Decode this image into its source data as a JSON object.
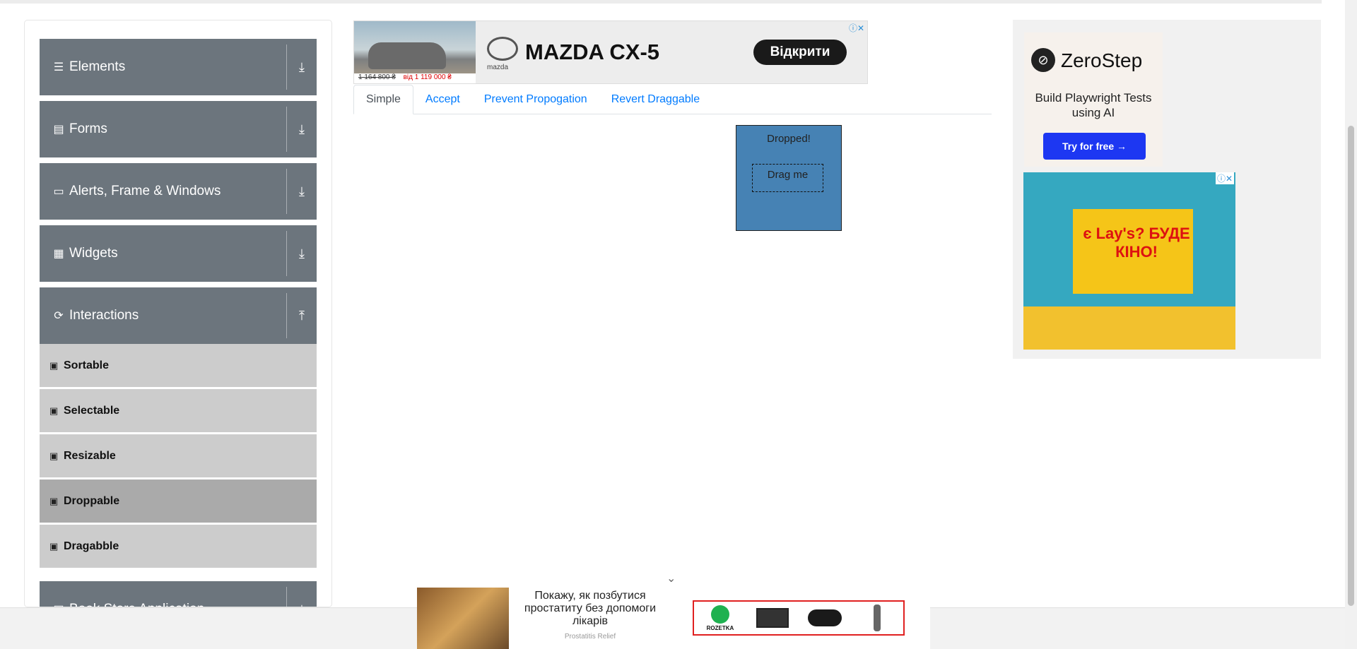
{
  "sidebar": {
    "groups": [
      {
        "label": "Elements",
        "icon": "menu-icon"
      },
      {
        "label": "Forms",
        "icon": "form-icon"
      },
      {
        "label": "Alerts, Frame & Windows",
        "icon": "window-icon"
      },
      {
        "label": "Widgets",
        "icon": "widgets-icon"
      },
      {
        "label": "Interactions",
        "icon": "interactions-icon"
      },
      {
        "label": "Book Store Application",
        "icon": "book-icon"
      }
    ],
    "interaction_items": [
      {
        "label": "Sortable"
      },
      {
        "label": "Selectable"
      },
      {
        "label": "Resizable"
      },
      {
        "label": "Droppable",
        "active": true
      },
      {
        "label": "Dragabble"
      }
    ]
  },
  "top_ad": {
    "old_price": "1 164 800 ₴",
    "new_price": "від 1 119 000 ₴",
    "brand": "mazda",
    "model": "MAZDA CX-5",
    "cta": "Відкрити"
  },
  "tabs": [
    {
      "label": "Simple",
      "active": true
    },
    {
      "label": "Accept"
    },
    {
      "label": "Prevent Propogation"
    },
    {
      "label": "Revert Draggable"
    }
  ],
  "droppable": {
    "drop_text": "Dropped!",
    "drag_text": "Drag me",
    "drop_color": "#4682b4"
  },
  "right_ad": {
    "title": "ZeroStep",
    "subtitle": "Build Playwright Tests using AI",
    "cta": "Try for free →",
    "lays_headline": "є Lay's? БУДЕ КІНО!"
  },
  "bottom_ad": {
    "text": "Покажу, як позбутися простатиту без допомоги лікарів",
    "source": "Prostatitis Relief",
    "shop_label": "ROZETKA"
  },
  "colors": {
    "group_header": "#6c757d",
    "menu_item": "#cccccc",
    "menu_item_active": "#aaaaaa",
    "link": "#007bff"
  }
}
